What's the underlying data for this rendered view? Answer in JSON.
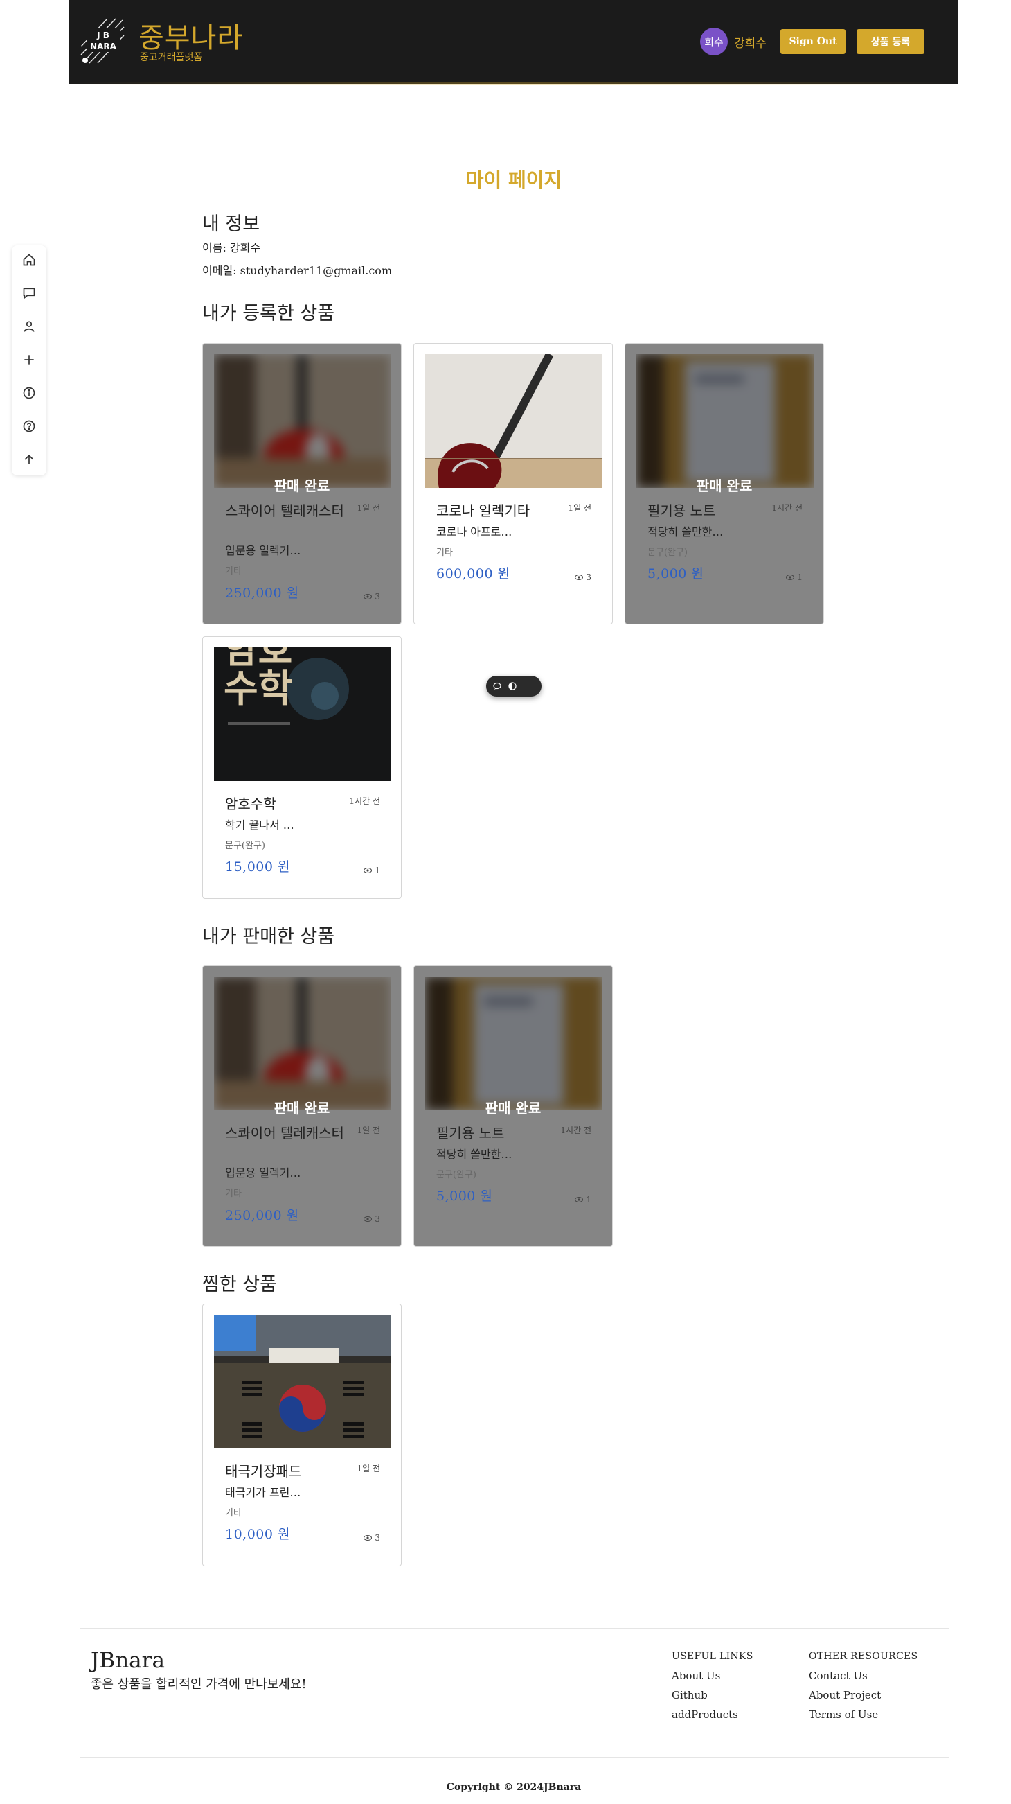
{
  "header": {
    "logo_text_top": "J B",
    "logo_text_bottom": "NARA",
    "title": "중부나라",
    "subtitle": "중고거래플랫폼",
    "avatar_text": "희수",
    "user_name": "강희수",
    "sign_out": "Sign Out",
    "register": "상품 등록"
  },
  "sidenav": {
    "items": [
      "home-icon",
      "chat-icon",
      "user-icon",
      "plus-icon",
      "info-icon",
      "help-icon",
      "arrow-up-icon"
    ]
  },
  "page": {
    "title": "마이 페이지",
    "info_heading": "내 정보",
    "name_line": "이름: 강희수",
    "email_line": "이메일: studyharder11@gmail.com",
    "registered_heading": "내가 등록한 상품",
    "sold_heading": "내가 판매한 상품",
    "liked_heading": "찜한 상품",
    "sold_badge": "판매 완료"
  },
  "registered": [
    {
      "name": "스콰이어 텔레캐스터",
      "time": "1일 전",
      "desc": "입문용 일렉기…",
      "category": "기타",
      "price": "250,000 원",
      "views": "3",
      "sold": true
    },
    {
      "name": "코로나 일렉기타",
      "time": "1일 전",
      "desc": "코로나 아프로…",
      "category": "기타",
      "price": "600,000 원",
      "views": "3",
      "sold": false
    },
    {
      "name": "필기용 노트",
      "time": "1시간 전",
      "desc": "적당히 쓸만한…",
      "category": "문구(완구)",
      "price": "5,000 원",
      "views": "1",
      "sold": true
    },
    {
      "name": "암호수학",
      "time": "1시간 전",
      "desc": "학기 끝나서 …",
      "category": "문구(완구)",
      "price": "15,000 원",
      "views": "1",
      "sold": false,
      "cover_text": "암호\n수학"
    }
  ],
  "sold": [
    {
      "name": "스콰이어 텔레캐스터",
      "time": "1일 전",
      "desc": "입문용 일렉기…",
      "category": "기타",
      "price": "250,000 원",
      "views": "3"
    },
    {
      "name": "필기용 노트",
      "time": "1시간 전",
      "desc": "적당히 쓸만한…",
      "category": "문구(완구)",
      "price": "5,000 원",
      "views": "1"
    }
  ],
  "liked": [
    {
      "name": "태극기장패드",
      "time": "1일 전",
      "desc": "태극기가 프린…",
      "category": "기타",
      "price": "10,000 원",
      "views": "3"
    }
  ],
  "footer": {
    "brand": "JBnara",
    "tagline": "좋은 상품을 합리적인 가격에 만나보세요!",
    "useful_title": "USEFUL LINKS",
    "useful_links": [
      "About Us",
      "Github",
      "addProducts"
    ],
    "other_title": "OTHER RESOURCES",
    "other_links": [
      "Contact Us",
      "About Project",
      "Terms of Use"
    ],
    "copyright": "Copyright © 2024JBnara"
  },
  "colors": {
    "accent": "#d4a82c",
    "header_bg": "#1b1b1b",
    "price": "#2d5fc4",
    "avatar": "#7a52c7"
  }
}
